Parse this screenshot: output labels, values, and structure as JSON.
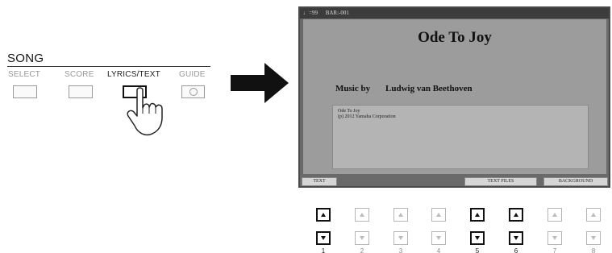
{
  "panel": {
    "title": "SONG",
    "buttons": [
      {
        "label": "SELECT",
        "active": false
      },
      {
        "label": "SCORE",
        "active": false
      },
      {
        "label": "LYRICS/TEXT",
        "active": true
      },
      {
        "label": "GUIDE",
        "active": false
      }
    ]
  },
  "display": {
    "status_tempo": "♩=99",
    "status_bar": "BAR:-001",
    "song_title": "Ode To Joy",
    "music_by_label": "Music by",
    "composer": "Ludwig van Beethoven",
    "text_lines": [
      "Ode To Joy",
      "(p) 2012 Yamaha Corporation"
    ],
    "tabs": {
      "text": "TEXT",
      "text_files": "TEXT FILES",
      "background": "BACKGROUND"
    }
  },
  "number_buttons": [
    {
      "number": "1",
      "active": true
    },
    {
      "number": "2",
      "active": false
    },
    {
      "number": "3",
      "active": false
    },
    {
      "number": "4",
      "active": false
    },
    {
      "number": "5",
      "active": true
    },
    {
      "number": "6",
      "active": true
    },
    {
      "number": "7",
      "active": false
    },
    {
      "number": "8",
      "active": false
    }
  ]
}
